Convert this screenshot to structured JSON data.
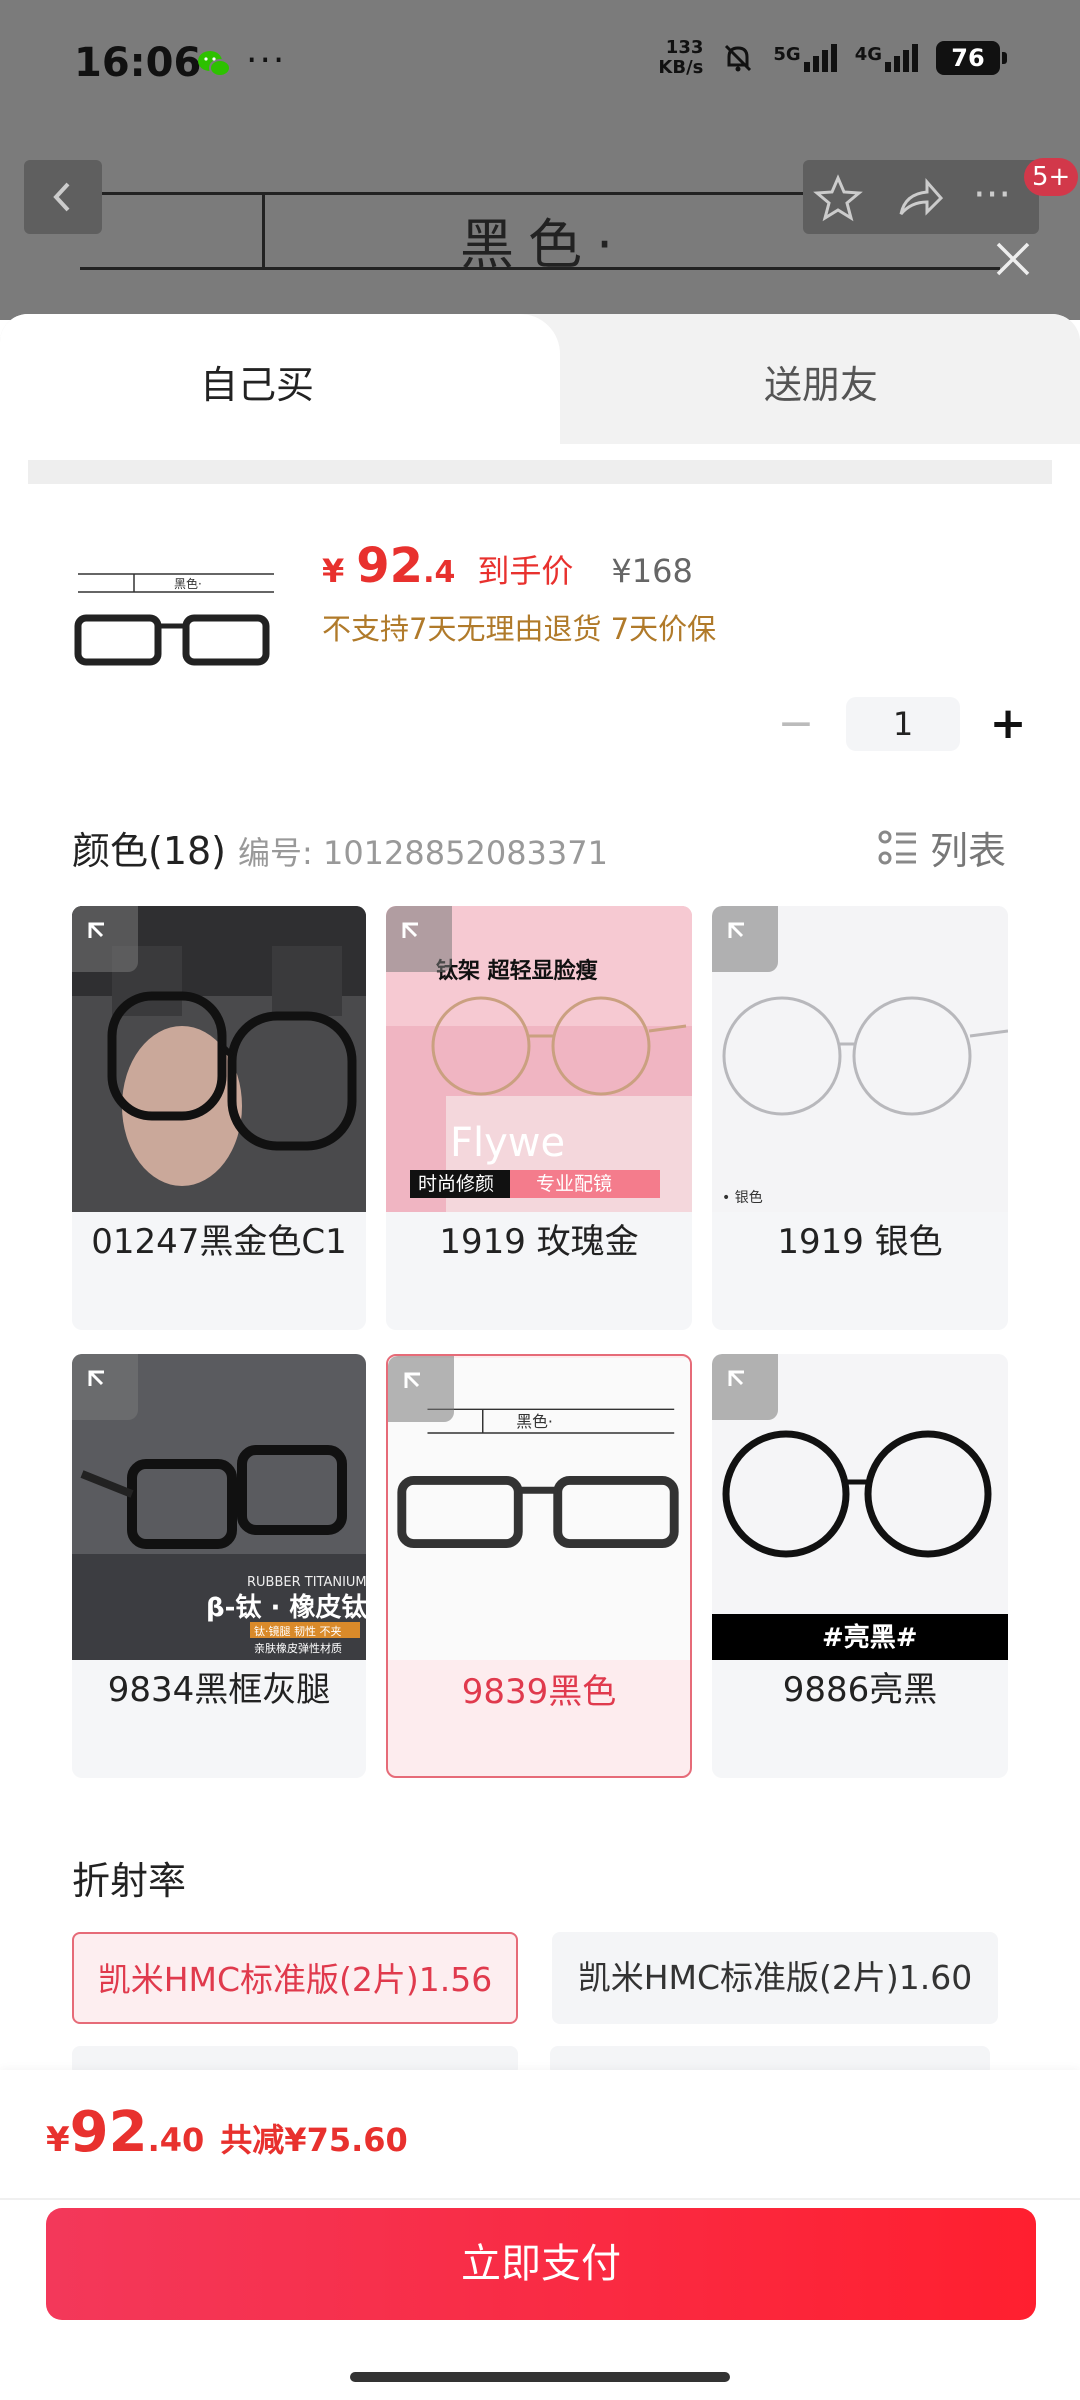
{
  "status_bar": {
    "time": "16:06",
    "net_speed_value": "133",
    "net_speed_unit": "KB/s",
    "signal1_label": "5G",
    "signal2_label": "4G",
    "battery": "76",
    "badge": "5+"
  },
  "banner": {
    "text": "黑色·"
  },
  "tabs": {
    "self": "自己买",
    "friend": "送朋友"
  },
  "product": {
    "currency": "¥",
    "price_int": "92",
    "price_dec": ".4",
    "price_label": "到手价",
    "original_price": "¥168",
    "policy": "不支持7天无理由退货  7天价保",
    "thumb_text": "黑色·",
    "quantity": "1",
    "minus": "−",
    "plus": "+"
  },
  "colors": {
    "title": "颜色(18)",
    "code": "编号: 10128852083371",
    "view_toggle": "列表",
    "items": [
      {
        "label": "01247黑金色C1",
        "selected": false
      },
      {
        "label": "1919 玫瑰金",
        "selected": false,
        "overlay_title": "钛架  超轻显脸瘦",
        "overlay_brand": "Flywe",
        "overlay_tag1": "时尚修颜",
        "overlay_tag2": "专业配镜"
      },
      {
        "label": "1919 银色",
        "selected": false,
        "overlay_note": "• 银色"
      },
      {
        "label": "9834黑框灰腿",
        "selected": false,
        "overlay_brand": "RUBBER TITANIUM",
        "overlay_title": "β-钛 · 橡皮钛",
        "overlay_tag1": "钛·镜腿 韧性 不夹",
        "overlay_tag2": "亲肤橡皮弹性材质"
      },
      {
        "label": "9839黑色",
        "selected": true,
        "overlay_title": "黑色·"
      },
      {
        "label": "9886亮黑",
        "selected": false,
        "overlay_title": "#亮黑#"
      }
    ]
  },
  "refraction": {
    "title": "折射率",
    "options": [
      {
        "label": "凯米HMC标准版(2片)1.56",
        "selected": true
      },
      {
        "label": "凯米HMC标准版(2片)1.60",
        "selected": false
      }
    ]
  },
  "footer": {
    "currency": "¥",
    "total_int": "92",
    "total_dec": ".40",
    "savings": "共减¥75.60",
    "pay_button": "立即支付"
  },
  "colors_theme": {
    "accent": "#e8312e",
    "selected_border": "#e66b78",
    "policy": "#b07a2a"
  }
}
